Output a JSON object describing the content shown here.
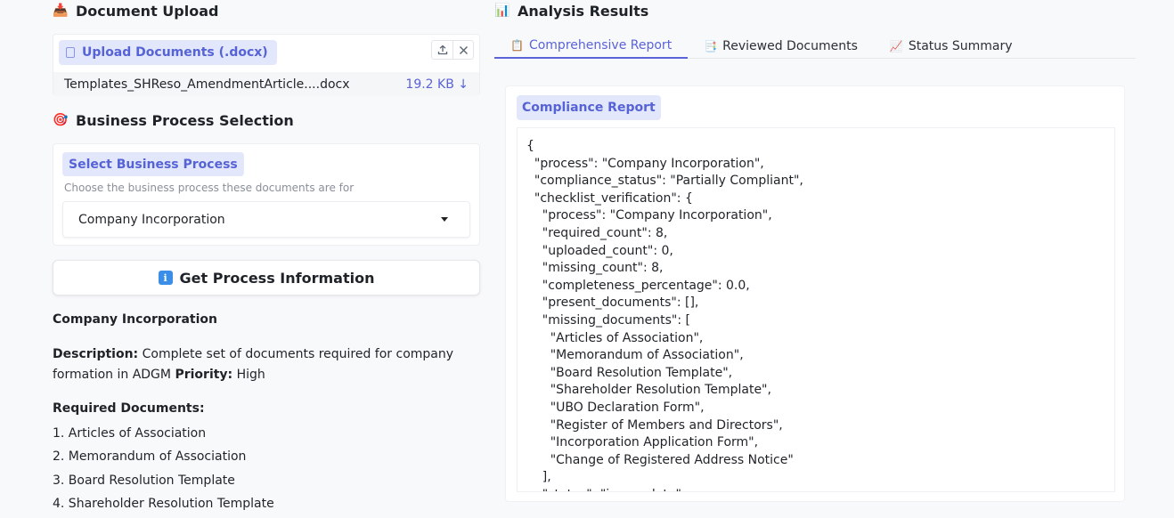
{
  "left": {
    "upload": {
      "title": "Document Upload",
      "title_icon": "inbox-tray-icon",
      "label": "Upload Documents (.docx)",
      "file_name": "Templates_SHReso_AmendmentArticle....docx",
      "file_size": "19.2 KB ↓"
    },
    "business_process": {
      "title": "Business Process Selection",
      "title_icon": "target-icon",
      "label": "Select Business Process",
      "hint": "Choose the business process these documents are for",
      "selected": "Company Incorporation"
    },
    "button": {
      "label": "Get Process Information",
      "icon": "info-icon"
    },
    "info": {
      "process_name": "Company Incorporation",
      "description_label": "Description:",
      "description": "Complete set of documents required for company formation in ADGM",
      "priority_label": "Priority:",
      "priority": "High",
      "required_label": "Required Documents:",
      "required_docs": [
        "1. Articles of Association",
        "2. Memorandum of Association",
        "3. Board Resolution Template",
        "4. Shareholder Resolution Template"
      ]
    }
  },
  "right": {
    "title": "Analysis Results",
    "title_icon": "bar-chart-icon",
    "tabs": [
      {
        "label": "Comprehensive Report",
        "icon": "clipboard-icon",
        "active": true
      },
      {
        "label": "Reviewed Documents",
        "icon": "document-icon",
        "active": false
      },
      {
        "label": "Status Summary",
        "icon": "trend-chart-icon",
        "active": false
      }
    ],
    "report_label": "Compliance Report",
    "report_lines": [
      "{",
      "  \"process\": \"Company Incorporation\",",
      "  \"compliance_status\": \"Partially Compliant\",",
      "  \"checklist_verification\": {",
      "    \"process\": \"Company Incorporation\",",
      "    \"required_count\": 8,",
      "    \"uploaded_count\": 0,",
      "    \"missing_count\": 8,",
      "    \"completeness_percentage\": 0.0,",
      "    \"present_documents\": [],",
      "    \"missing_documents\": [",
      "      \"Articles of Association\",",
      "      \"Memorandum of Association\",",
      "      \"Board Resolution Template\",",
      "      \"Shareholder Resolution Template\",",
      "      \"UBO Declaration Form\",",
      "      \"Register of Members and Directors\",",
      "      \"Incorporation Application Form\",",
      "      \"Change of Registered Address Notice\"",
      "    ],",
      "    \"status\": \"incomplete\""
    ]
  },
  "colors": {
    "accent": "#5a63d8",
    "chip_bg": "#e3e7fb",
    "page_bg": "#f8f9fb"
  }
}
